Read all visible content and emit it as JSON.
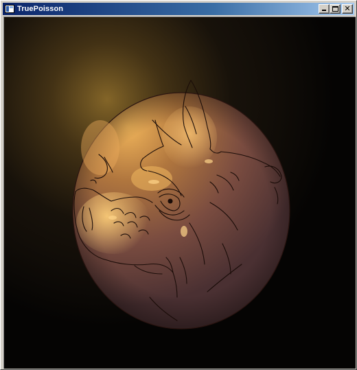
{
  "window": {
    "title": "TruePoisson",
    "icon": "app-window-icon",
    "buttons": [
      {
        "name": "minimize",
        "icon": "minimize-icon"
      },
      {
        "name": "maximize",
        "icon": "maximize-icon"
      },
      {
        "name": "close",
        "icon": "close-icon",
        "glyph": "✕"
      }
    ]
  },
  "canvas": {
    "content": "rendered-image",
    "colors": {
      "background": "#050403",
      "glow": "#8a6a2a",
      "sphere_highlight": "#f0b45a",
      "sphere_mid": "#b0763e",
      "sphere_shadow": "#4a3032",
      "line_color": "#1a0c08"
    }
  }
}
